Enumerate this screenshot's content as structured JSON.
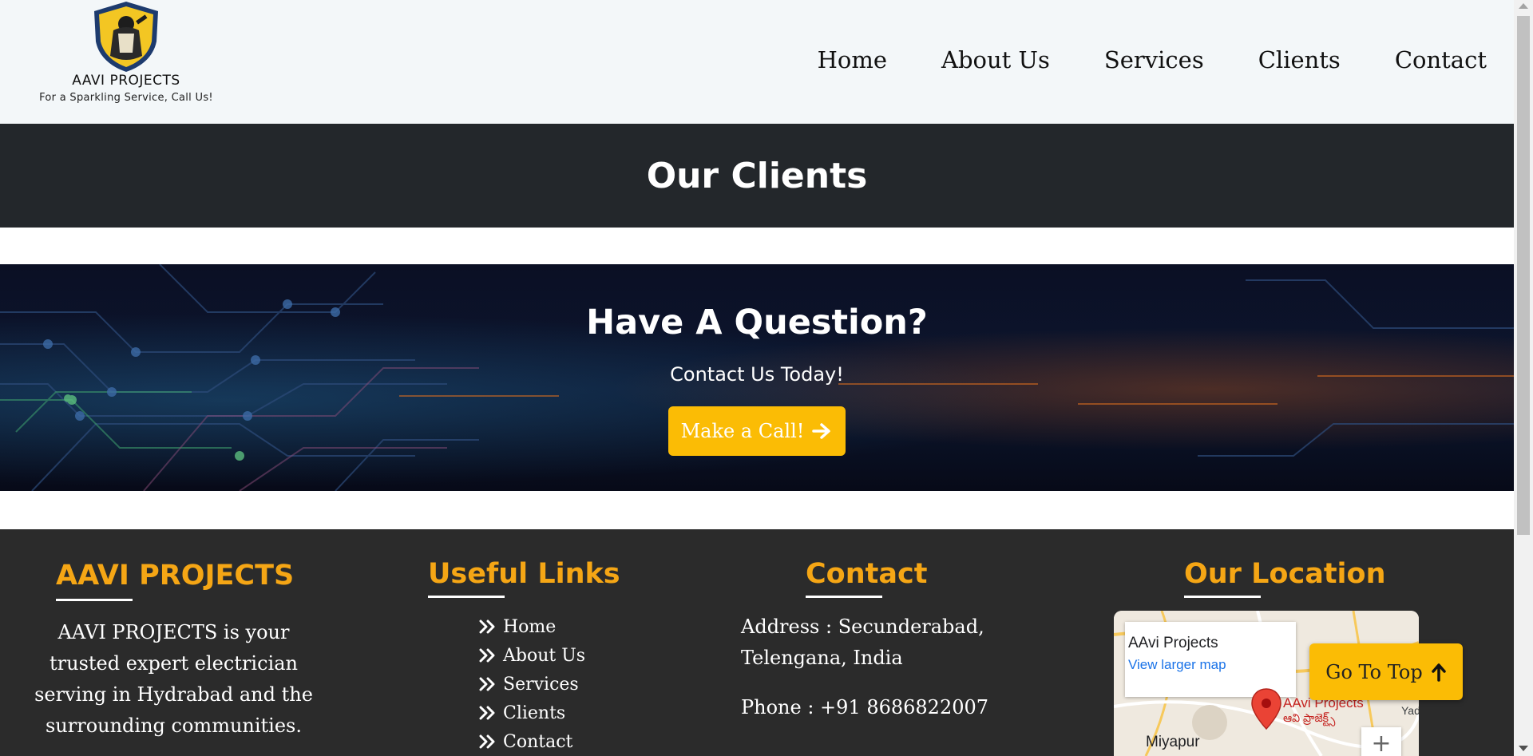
{
  "header": {
    "brand": "AAVI PROJECTS",
    "tagline": "For a Sparkling Service, Call Us!",
    "logo_icon": "electrician-shield-logo-icon",
    "nav": [
      {
        "label": "Home"
      },
      {
        "label": "About Us"
      },
      {
        "label": "Services"
      },
      {
        "label": "Clients"
      },
      {
        "label": "Contact"
      }
    ]
  },
  "title_band": {
    "title": "Our Clients"
  },
  "hero": {
    "title": "Have A Question?",
    "subtitle": "Contact Us Today!",
    "button_label": "Make a Call!",
    "button_icon": "arrow-right-icon"
  },
  "footer": {
    "about": {
      "title": "AAVI PROJECTS",
      "text": "AAVI PROJECTS is your trusted expert electrician serving in Hydrabad and the surrounding communities."
    },
    "links": {
      "title": "Useful Links",
      "items": [
        {
          "label": "Home"
        },
        {
          "label": "About Us"
        },
        {
          "label": "Services"
        },
        {
          "label": "Clients"
        },
        {
          "label": "Contact"
        }
      ]
    },
    "contact": {
      "title": "Contact",
      "address": "Address : Secunderabad, Telengana, India",
      "phone": "Phone : +91 8686822007"
    },
    "location": {
      "title": "Our Location",
      "map_card_title": "AAvi Projects",
      "map_card_link": "View larger map",
      "pin_label": "AAvi Projects",
      "pin_label_local": "ఆవి ప్రాజెక్ట్స్",
      "place_name": "Miyapur",
      "place_name_2": "Yad",
      "zoom_in": "+"
    }
  },
  "go_top": {
    "label": "Go To Top",
    "icon": "arrow-up-icon"
  },
  "colors": {
    "accent": "#fbbc05",
    "footer_heading": "#f5a615",
    "title_band": "#23272b",
    "footer_bg": "#2b2b2b"
  }
}
